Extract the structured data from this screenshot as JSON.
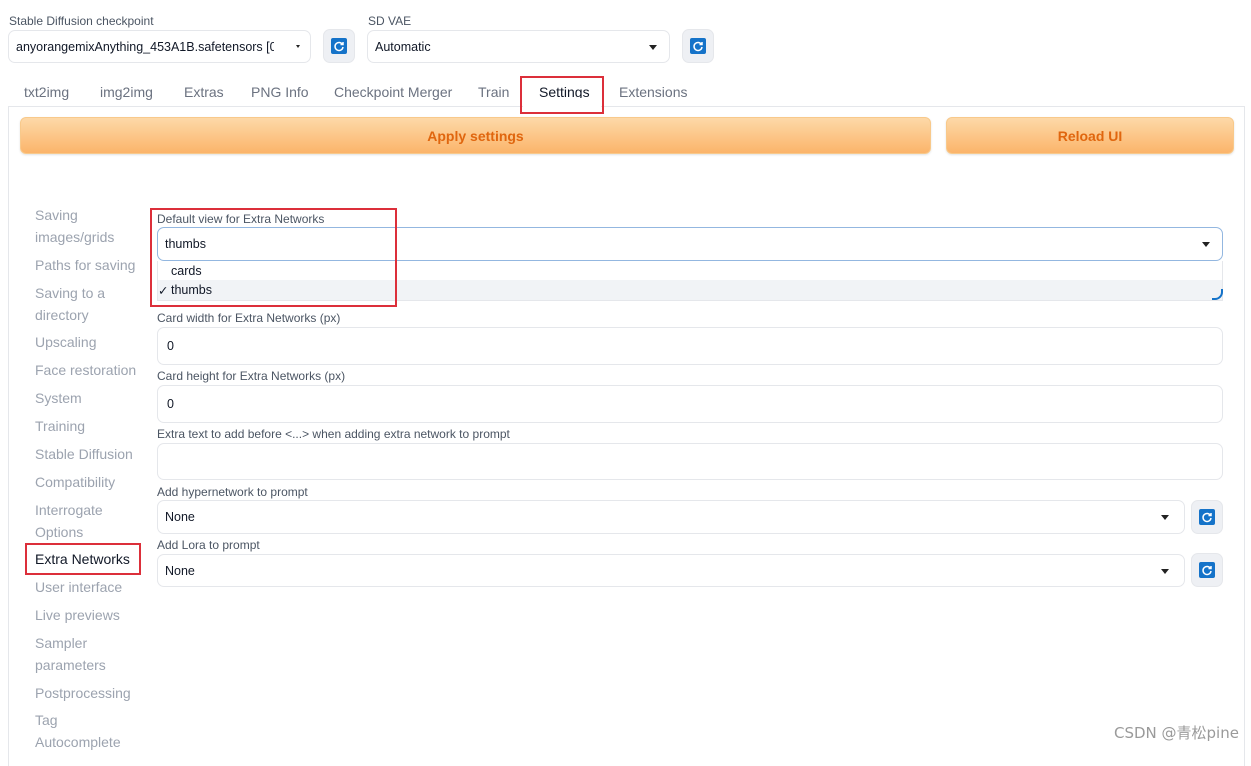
{
  "top": {
    "checkpoint_label": "Stable Diffusion checkpoint",
    "checkpoint_value": "anyorangemixAnything_453A1B.safetensors [0c3",
    "vae_label": "SD VAE",
    "vae_value": "Automatic"
  },
  "tabs": [
    "txt2img",
    "img2img",
    "Extras",
    "PNG Info",
    "Checkpoint Merger",
    "Train",
    "Settings",
    "Extensions"
  ],
  "actions": {
    "apply": "Apply settings",
    "reload": "Reload UI"
  },
  "sidebar": [
    "Saving images/grids",
    "Paths for saving",
    "Saving to a directory",
    "Upscaling",
    "Face restoration",
    "System",
    "Training",
    "Stable Diffusion",
    "Compatibility",
    "Interrogate Options",
    "Extra Networks",
    "User interface",
    "Live previews",
    "Sampler parameters",
    "Postprocessing",
    "Tag Autocomplete"
  ],
  "settings": {
    "default_view_label": "Default view for Extra Networks",
    "default_view_value": "thumbs",
    "default_view_options": [
      "cards",
      "thumbs"
    ],
    "check_mark": "✓",
    "card_width_label": "Card width for Extra Networks (px)",
    "card_width_value": "0",
    "card_height_label": "Card height for Extra Networks (px)",
    "card_height_value": "0",
    "extra_text_label": "Extra text to add before <...> when adding extra network to prompt",
    "extra_text_value": "",
    "hypernetwork_label": "Add hypernetwork to prompt",
    "hypernetwork_value": "None",
    "lora_label": "Add Lora to prompt",
    "lora_value": "None"
  },
  "watermark": "CSDN @青松pine",
  "colors": {
    "accent_orange": "#e0660e",
    "highlight_red": "#dc2f3a",
    "refresh_blue": "#1573c9"
  }
}
